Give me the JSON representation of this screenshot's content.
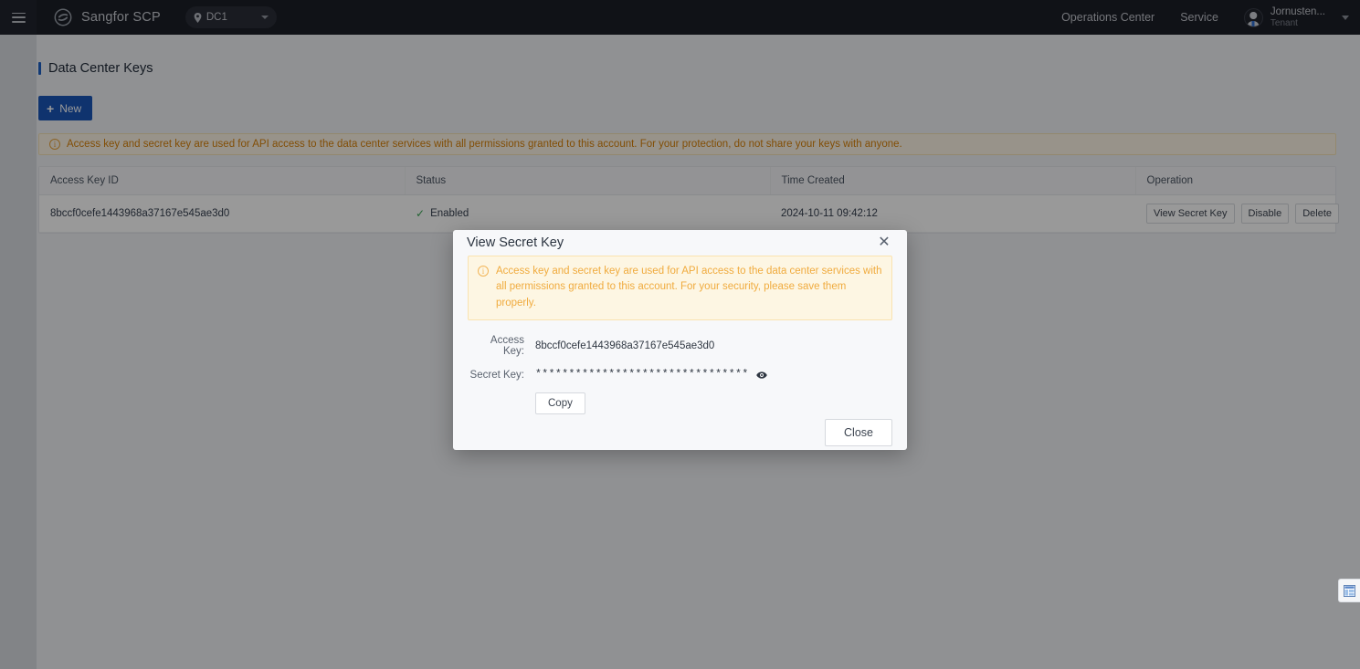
{
  "header": {
    "menu_icon": "hamburger-menu-icon",
    "brand_logo_icon": "sangfor-logo-icon",
    "brand_name": "Sangfor SCP",
    "datacenter": {
      "pin_icon": "location-pin-icon",
      "label": "DC1",
      "caret_icon": "chevron-down-icon"
    },
    "nav": [
      {
        "label": "Operations Center"
      },
      {
        "label": "Service"
      }
    ],
    "user": {
      "avatar_icon": "user-avatar-icon",
      "name": "Jornusten...",
      "role": "Tenant",
      "caret_icon": "chevron-down-icon"
    }
  },
  "page": {
    "title": "Data Center Keys",
    "new_button": {
      "label": "New",
      "icon": "plus-icon"
    },
    "alert": {
      "icon": "info-circle-icon",
      "text": "Access key and secret key are used for API access to the data center services with all permissions granted to this account. For your protection, do not share your keys with anyone."
    }
  },
  "table": {
    "columns": [
      "Access Key ID",
      "Status",
      "Time Created",
      "Operation"
    ],
    "rows": [
      {
        "access_key_id": "8bccf0cefe1443968a37167e545ae3d0",
        "status": "Enabled",
        "status_icon": "check-icon",
        "time_created": "2024-10-11 09:42:12",
        "operations": [
          "View Secret Key",
          "Disable",
          "Delete"
        ]
      }
    ]
  },
  "modal": {
    "title": "View Secret Key",
    "close_icon": "close-icon",
    "alert": {
      "icon": "info-circle-icon",
      "text": "Access key and secret key are used for API access to the data center services with all permissions granted to this account. For your security, please save them properly."
    },
    "fields": {
      "access_key_label": "Access Key:",
      "access_key_value": "8bccf0cefe1443968a37167e545ae3d0",
      "secret_key_label": "Secret Key:",
      "secret_key_value": "********************************",
      "secret_key_toggle_icon": "eye-icon"
    },
    "copy_button": "Copy",
    "close_button": "Close"
  },
  "float_widget": {
    "icon": "panel-layout-icon"
  },
  "colors": {
    "header_bg": "#1b1e27",
    "primary": "#1a56b8",
    "accent_title_bar": "#1d5fc4",
    "warning_text": "#d9820a",
    "warning_bg": "#fdf6e3",
    "success": "#3aa655",
    "page_bg": "#f0f2f5"
  }
}
